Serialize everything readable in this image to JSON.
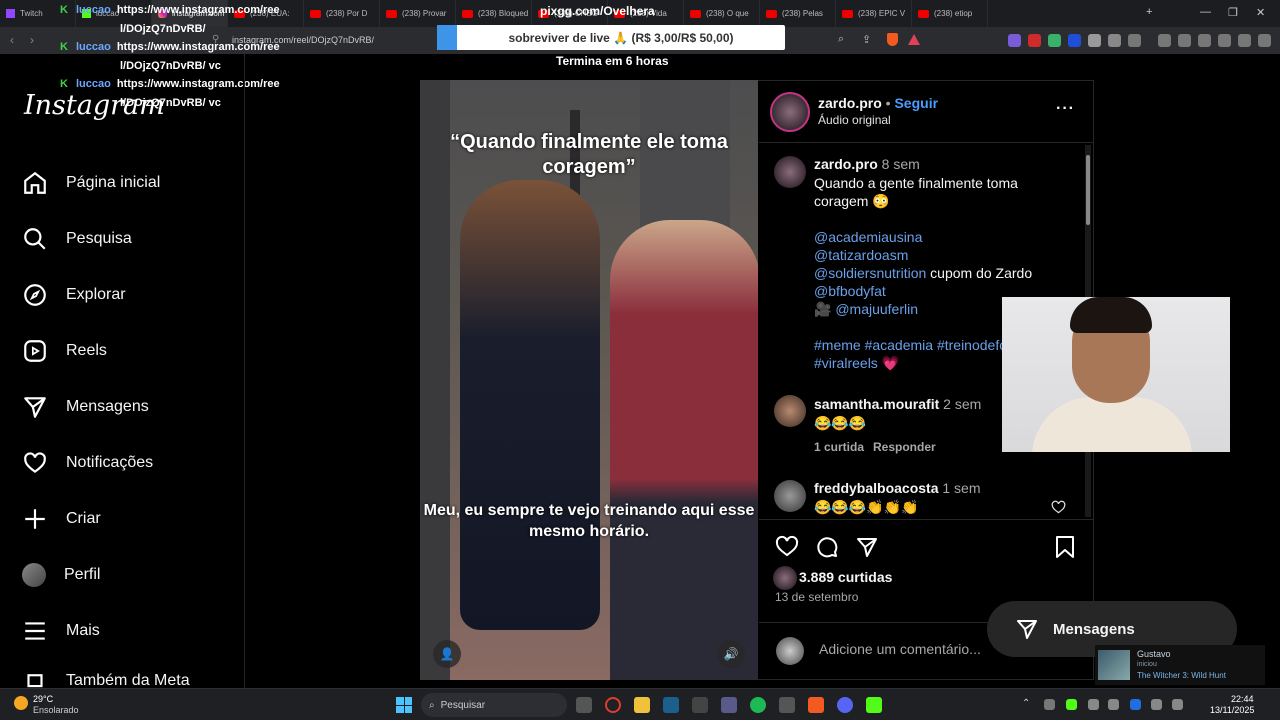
{
  "browser": {
    "tabs": [
      {
        "label": "Twitch",
        "kind": "twitch"
      },
      {
        "label": "luccao",
        "kind": "k"
      },
      {
        "label": "instagram.com",
        "kind": "ig",
        "active": true
      },
      {
        "label": "(238) EUA:",
        "kind": "yt"
      },
      {
        "label": "(238) Por D",
        "kind": "yt"
      },
      {
        "label": "(238) Provar",
        "kind": "yt"
      },
      {
        "label": "(238) Bloqued",
        "kind": "yt"
      },
      {
        "label": "(238) CHEG",
        "kind": "yt"
      },
      {
        "label": "(238) Vida",
        "kind": "yt"
      },
      {
        "label": "(238) O que",
        "kind": "yt"
      },
      {
        "label": "(238) Pelas",
        "kind": "yt"
      },
      {
        "label": "(238) EPIC V",
        "kind": "yt"
      },
      {
        "label": "(238) etiop",
        "kind": "yt"
      }
    ],
    "url": "instagram.com/reel/DOjzQ7nDvRB/",
    "new_tab": "+"
  },
  "stream_overlay": {
    "pix": "pixgg.com/Ovelhera",
    "donation": "sobreviver de live 🙏 (R$ 3,00/R$ 50,00)",
    "timer": "Termina em 6 horas",
    "chat": [
      {
        "user": "luccao",
        "msg": "https://www.instagram.com/ree"
      },
      {
        "user": "",
        "msg": "l/DOjzQ7nDvRB/"
      },
      {
        "user": "luccao",
        "msg": "https://www.instagram.com/ree"
      },
      {
        "user": "",
        "msg": "l/DOjzQ7nDvRB/ vc"
      },
      {
        "user": "luccao",
        "msg": "https://www.instagram.com/ree"
      },
      {
        "user": "",
        "msg": "l/DOjzQ7nDvRB/ vc"
      }
    ]
  },
  "sidebar": {
    "logo": "Instagram",
    "items": [
      {
        "label": "Página inicial",
        "icon": "home-icon"
      },
      {
        "label": "Pesquisa",
        "icon": "search-icon"
      },
      {
        "label": "Explorar",
        "icon": "compass-icon"
      },
      {
        "label": "Reels",
        "icon": "reels-icon"
      },
      {
        "label": "Mensagens",
        "icon": "messages-icon"
      },
      {
        "label": "Notificações",
        "icon": "heart-icon"
      },
      {
        "label": "Criar",
        "icon": "plus-icon"
      },
      {
        "label": "Perfil",
        "icon": "avatar"
      },
      {
        "label": "Mais",
        "icon": "menu-icon"
      },
      {
        "label": "Também da Meta",
        "icon": "meta-icon"
      }
    ]
  },
  "reel": {
    "caption_top": "“Quando finalmente ele toma coragem”",
    "caption_bottom": "Meu, eu sempre te vejo treinando aqui esse mesmo horário."
  },
  "post": {
    "author": "zardo.pro",
    "follow": "Seguir",
    "separator": "•",
    "audio": "Áudio original",
    "caption_time": "8 sem",
    "caption_text": "Quando a gente finalmente toma coragem 😳",
    "mentions": [
      "@academiausina",
      "@tatizardoasm"
    ],
    "sponsor_mention": "@soldiersnutrition",
    "sponsor_text": "cupom do Zardo",
    "mention_bf": "@bfbodyfat",
    "camera_emoji": "🎥",
    "camera_mention": "@majuuferlin",
    "hashtags": "#meme #academia #treinodeforça",
    "hashtag_last": "#viralreels",
    "hashtag_emoji": "💗",
    "comments": [
      {
        "user": "samantha.mourafit",
        "time": "2 sem",
        "text": "😂😂😂",
        "likes": "1 curtida",
        "reply": "Responder"
      },
      {
        "user": "freddybalboacosta",
        "time": "1 sem",
        "text": "😂😂😂👏👏👏"
      }
    ],
    "likes": "3.889 curtidas",
    "date": "13 de setembro",
    "comment_placeholder": "Adicione um comentário..."
  },
  "messages_pill": "Mensagens",
  "steam": {
    "user": "Gustavo",
    "status": "iniciou",
    "game": "The Witcher 3: Wild Hunt"
  },
  "taskbar": {
    "weather_temp": "29°C",
    "weather_desc": "Ensolarado",
    "search": "Pesquisar",
    "time": "22:44",
    "date": "13/11/2025"
  }
}
